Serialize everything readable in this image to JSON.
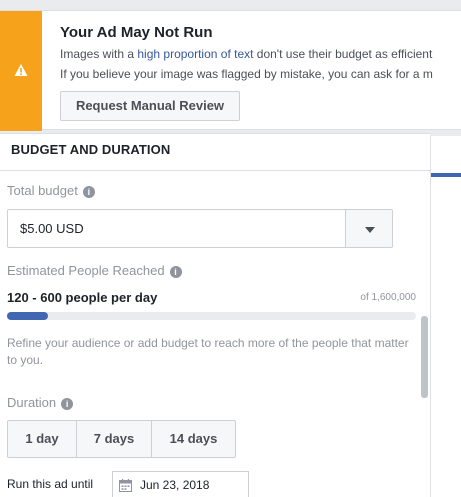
{
  "warning": {
    "title": "Your Ad May Not Run",
    "line1_prefix": "Images with a ",
    "line1_link": "high proportion of text",
    "line1_suffix": " don't use their budget as efficient",
    "line2": "If you believe your image was flagged by mistake, you can ask for a m",
    "button_label": "Request Manual Review",
    "icon": "warning-icon"
  },
  "budget_section": {
    "title": "BUDGET AND DURATION",
    "total_budget_label": "Total budget",
    "total_budget_value": "$5.00 USD",
    "reach_label": "Estimated People Reached",
    "reach_value": "120 - 600 people per day",
    "reach_total": "of 1,600,000",
    "reach_fill_fraction": 0.1,
    "reach_hint": "Refine your audience or add budget to reach more of the people that matter to you.",
    "duration_label": "Duration",
    "duration_options": [
      "1 day",
      "7 days",
      "14 days"
    ],
    "run_until_label": "Run this ad until",
    "run_until_date": "Jun 23, 2018"
  },
  "colors": {
    "warning_strip": "#f7a21b",
    "accent": "#4267b2",
    "link": "#365899"
  }
}
